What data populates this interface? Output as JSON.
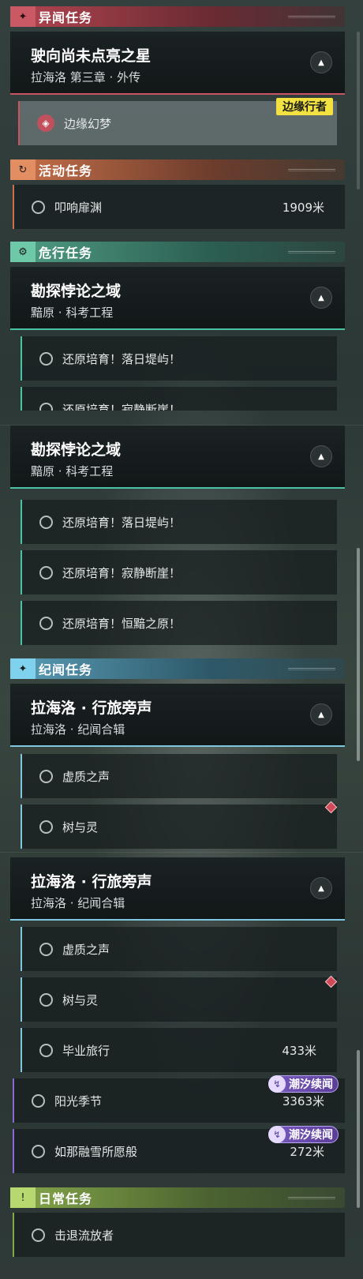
{
  "panel1": {
    "cat_yiwen": {
      "label": "异闻任务",
      "icon": "star-badge-icon"
    },
    "quest_main": {
      "title": "驶向尚未点亮之星",
      "subtitle": "拉海洛 第三章 · 外传"
    },
    "sub_bianyuan": {
      "label": "边缘幻梦",
      "tag": "边缘行者"
    },
    "cat_huodong": {
      "label": "活动任务",
      "icon": "refresh-icon"
    },
    "sub_kouxiang": {
      "label": "叩响扉渊",
      "distance": "1909米"
    },
    "cat_weixing": {
      "label": "危行任务",
      "icon": "gear-icon"
    },
    "quest_kantan": {
      "title": "勘探悖论之域",
      "subtitle": "黯原 · 科考工程"
    },
    "subs": [
      "还原培育！落日堤屿！",
      "还原培育！寂静断崖！"
    ]
  },
  "panel2": {
    "quest_kantan": {
      "title": "勘探悖论之域",
      "subtitle": "黯原 · 科考工程"
    },
    "subs": [
      "还原培育！落日堤屿！",
      "还原培育！寂静断崖！",
      "还原培育！恒黯之原！"
    ],
    "cat_jiwen": {
      "label": "纪闻任务",
      "icon": "sparkle-icon"
    },
    "quest_lahailuo": {
      "title": "拉海洛 · 行旅旁声",
      "subtitle": "拉海洛 · 纪闻合辑"
    },
    "subs2": [
      "虚质之声",
      "树与灵"
    ]
  },
  "panel3": {
    "quest_lahailuo": {
      "title": "拉海洛 · 行旅旁声",
      "subtitle": "拉海洛 · 纪闻合辑"
    },
    "sub_xuzhi": "虚质之声",
    "sub_shuyuling": "树与灵",
    "sub_biye": {
      "label": "毕业旅行",
      "distance": "433米"
    },
    "sub_yangguang": {
      "label": "阳光季节",
      "distance": "3363米",
      "tag": "潮汐续闻"
    },
    "sub_rongxue": {
      "label": "如那融雪所愿般",
      "distance": "272米",
      "tag": "潮汐续闻"
    },
    "cat_richang": {
      "label": "日常任务",
      "icon": "alert-icon"
    },
    "sub_jitui": "击退流放者"
  },
  "colors": {
    "yiwen": "#b34550",
    "huodong": "#c9714a",
    "weixing": "#4f9e84",
    "jiwen": "#5a9db8",
    "richang": "#86a84a",
    "tag_yellow": "#f2e141",
    "tag_purple": "#7a5ac0"
  }
}
